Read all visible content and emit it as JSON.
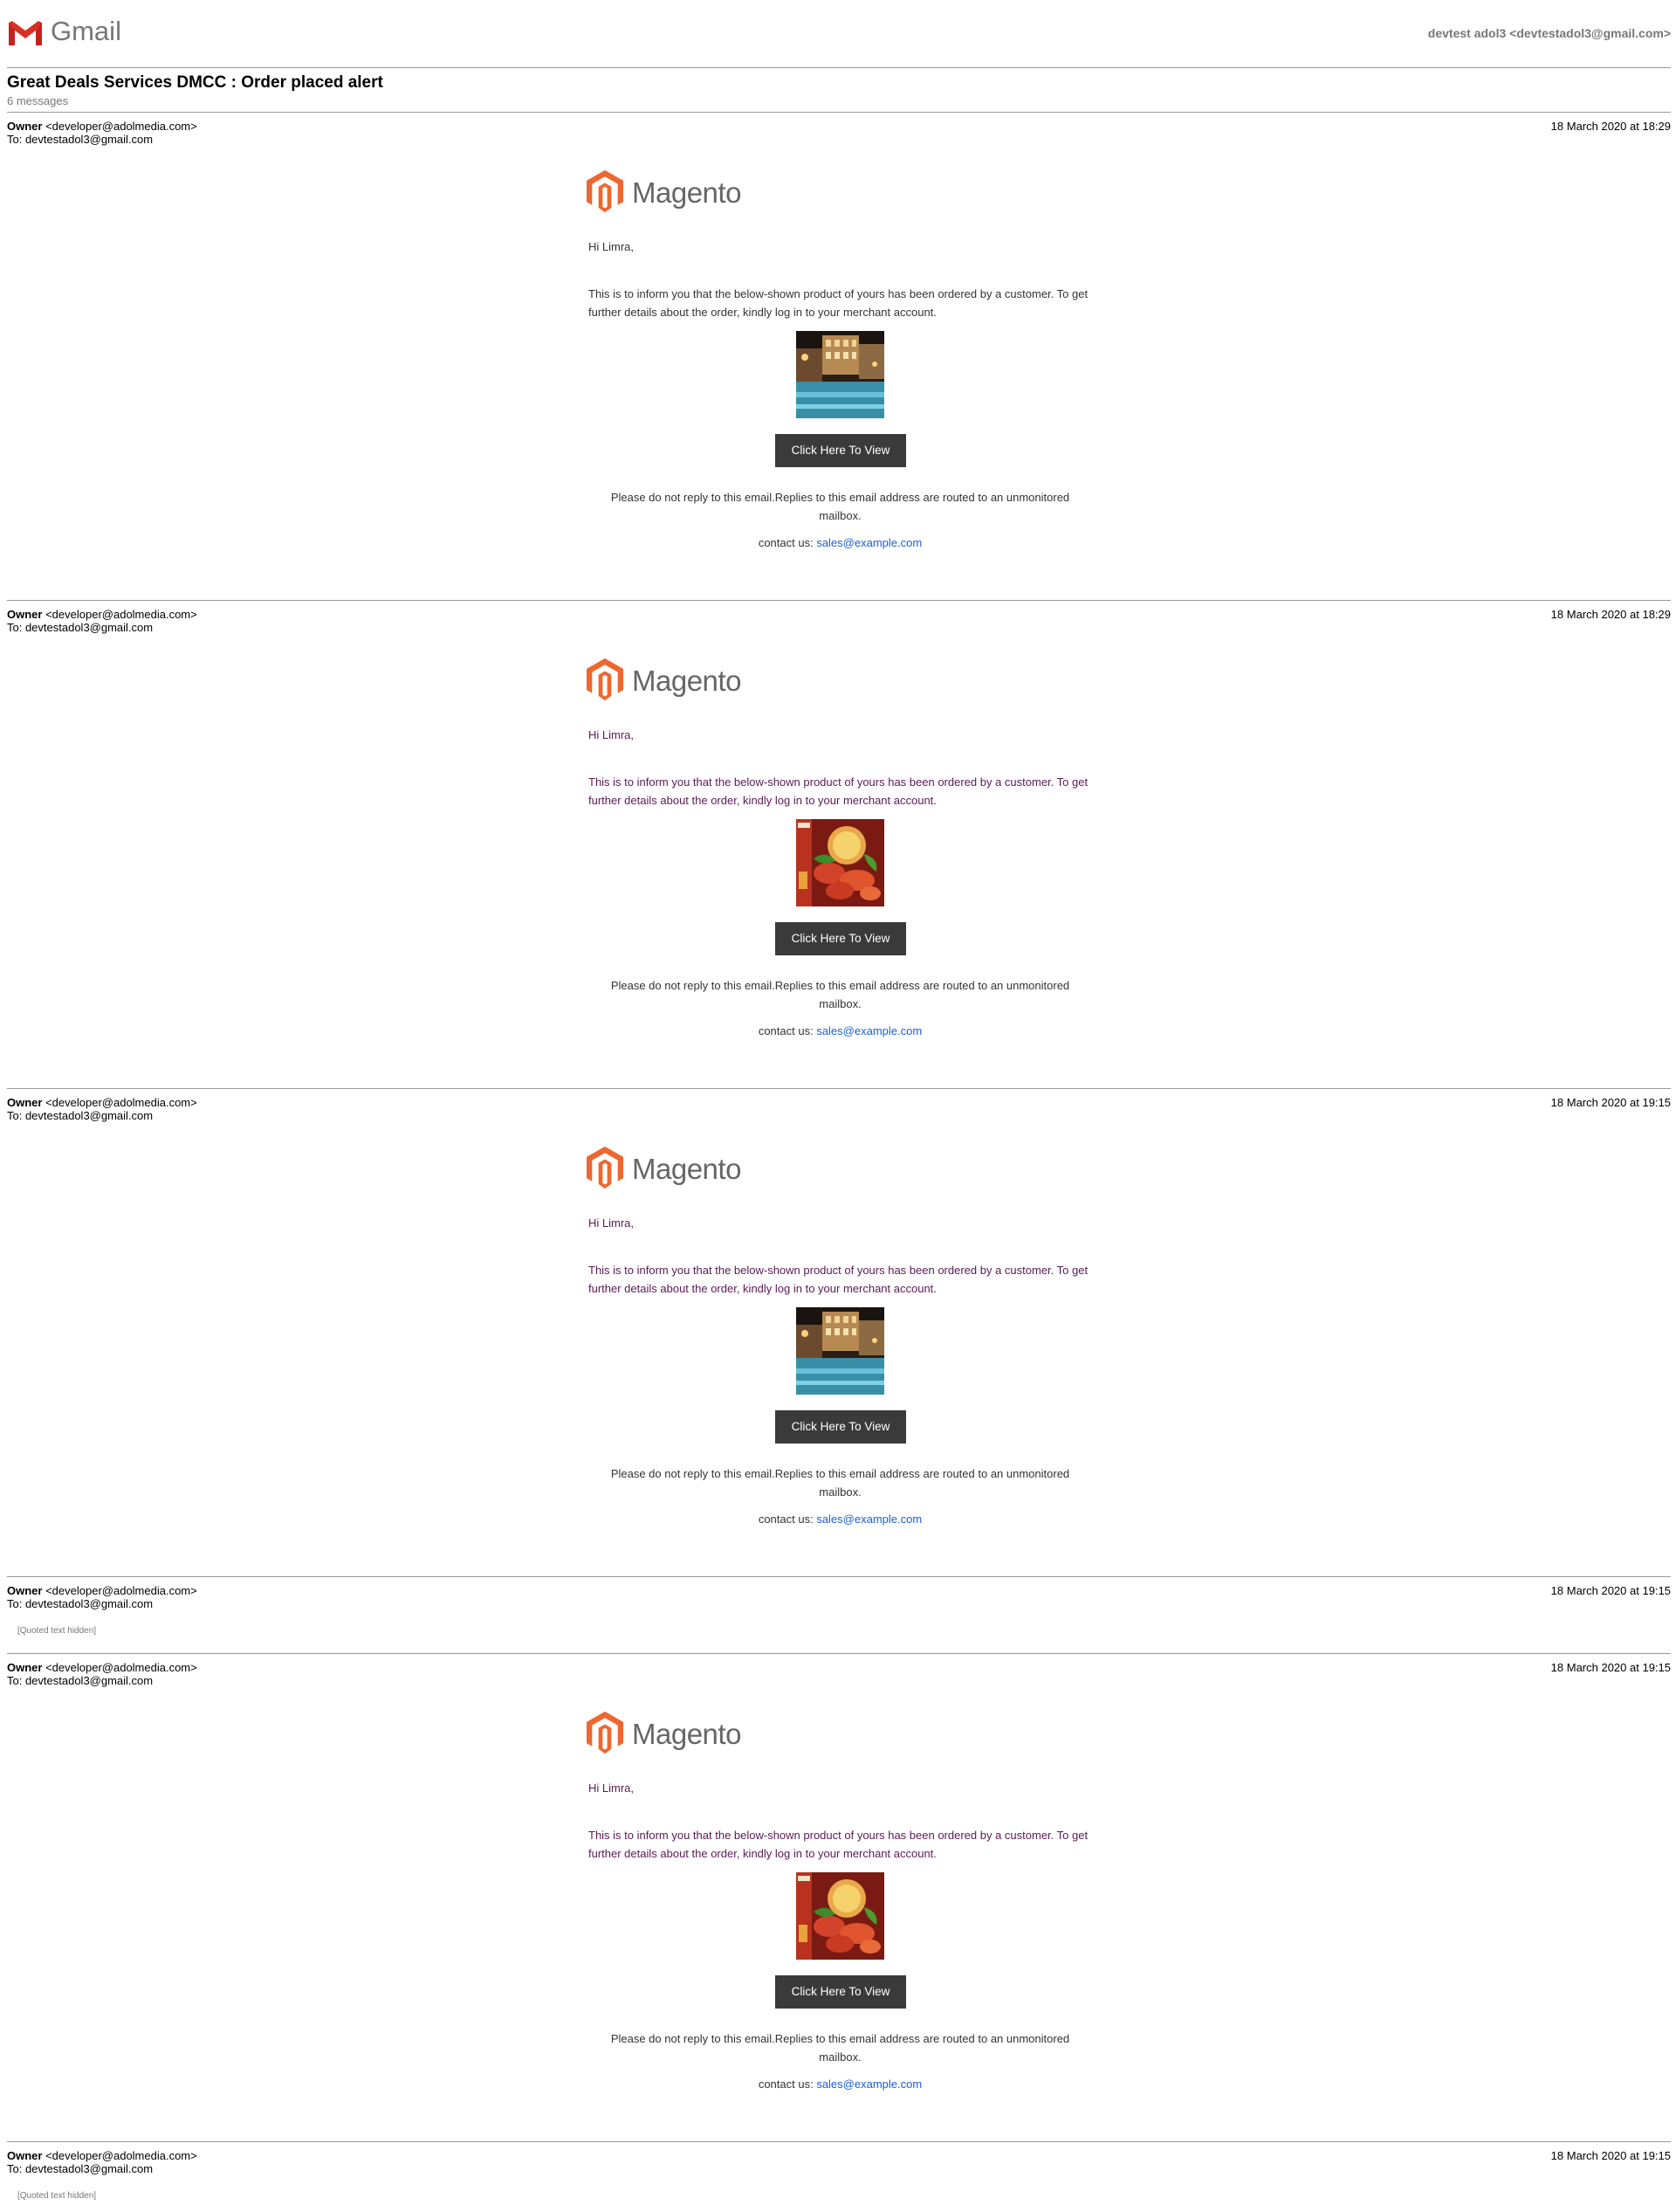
{
  "header": {
    "app_name": "Gmail",
    "account": "devtest adol3 <devtestadol3@gmail.com>"
  },
  "thread": {
    "subject": "Great Deals Services DMCC : Order placed alert",
    "count": "6 messages"
  },
  "messages": [
    {
      "from_name": "Owner",
      "from_email": "<developer@adolmedia.com>",
      "to": "To: devtestadol3@gmail.com",
      "date": "18 March 2020 at 18:29",
      "brand": "Magento",
      "greeting": "Hi Limra,",
      "intro": "This is to inform you that the below-shown product of yours has been ordered by a customer. To get further details about the order, kindly log in to your merchant account.",
      "product_image": "pool-hotel-image",
      "button": "Click Here To View",
      "note": "Please do not reply to this email.Replies to this email address are routed to an unmonitored mailbox.",
      "contact_label": "contact us:",
      "contact_email": "sales@example.com"
    },
    {
      "from_name": "Owner",
      "from_email": "<developer@adolmedia.com>",
      "to": "To: devtestadol3@gmail.com",
      "date": "18 March 2020 at 18:29",
      "brand": "Magento",
      "greeting": "Hi Limra,",
      "intro": "This is to inform you that the below-shown product of yours has been ordered by a customer. To get further details about the order, kindly log in to your merchant account.",
      "product_image": "seafood-dish-image",
      "button": "Click Here To View",
      "note": "Please do not reply to this email.Replies to this email address are routed to an unmonitored mailbox.",
      "contact_label": "contact us:",
      "contact_email": "sales@example.com"
    },
    {
      "from_name": "Owner",
      "from_email": "<developer@adolmedia.com>",
      "to": "To: devtestadol3@gmail.com",
      "date": "18 March 2020 at 19:15",
      "brand": "Magento",
      "greeting": "Hi Limra,",
      "intro": "This is to inform you that the below-shown product of yours has been ordered by a customer. To get further details about the order, kindly log in to your merchant account.",
      "product_image": "pool-hotel-image",
      "button": "Click Here To View",
      "note": "Please do not reply to this email.Replies to this email address are routed to an unmonitored mailbox.",
      "contact_label": "contact us:",
      "contact_email": "sales@example.com"
    },
    {
      "from_name": "Owner",
      "from_email": "<developer@adolmedia.com>",
      "to": "To: devtestadol3@gmail.com",
      "date": "18 March 2020 at 19:15",
      "quoted": "[Quoted text hidden]"
    },
    {
      "from_name": "Owner",
      "from_email": "<developer@adolmedia.com>",
      "to": "To: devtestadol3@gmail.com",
      "date": "18 March 2020 at 19:15",
      "brand": "Magento",
      "greeting": "Hi Limra,",
      "intro": "This is to inform you that the below-shown product of yours has been ordered by a customer. To get further details about the order, kindly log in to your merchant account.",
      "product_image": "seafood-dish-image",
      "button": "Click Here To View",
      "note": "Please do not reply to this email.Replies to this email address are routed to an unmonitored mailbox.",
      "contact_label": "contact us:",
      "contact_email": "sales@example.com"
    },
    {
      "from_name": "Owner",
      "from_email": "<developer@adolmedia.com>",
      "to": "To: devtestadol3@gmail.com",
      "date": "18 March 2020 at 19:15",
      "quoted": "[Quoted text hidden]"
    }
  ]
}
